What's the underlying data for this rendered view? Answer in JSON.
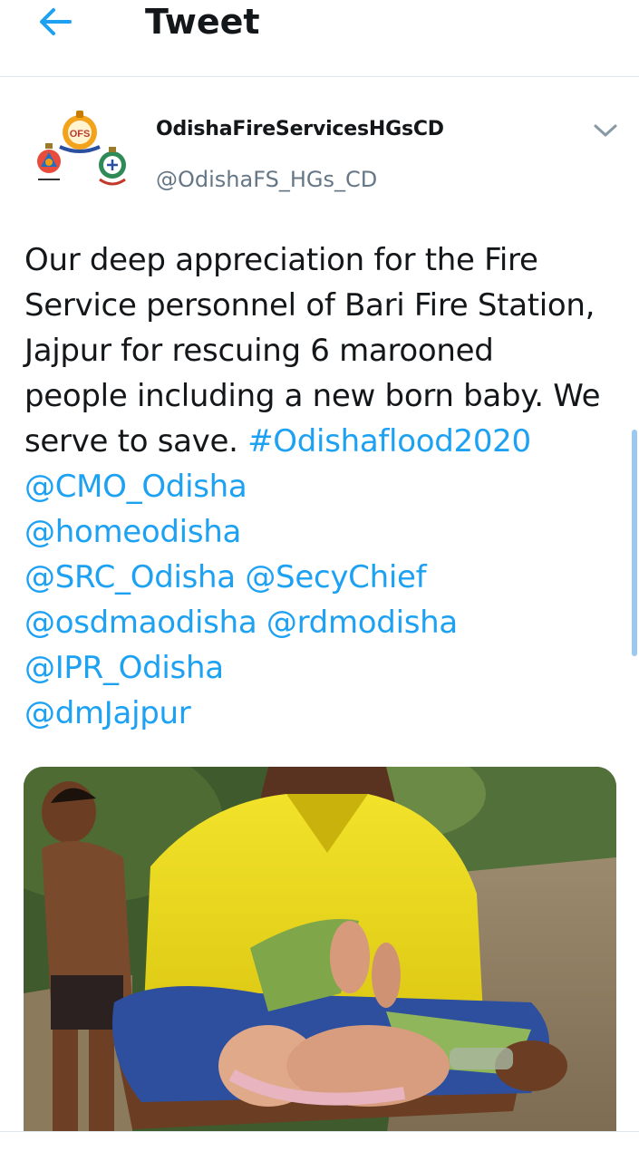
{
  "header": {
    "title": "Tweet",
    "back_icon": "arrow-left-icon"
  },
  "tweet": {
    "author_name": "OdishaFireServicesHGsCD",
    "author_handle": "@OdishaFS_HGs_CD",
    "avatar_logo_text": "OFS",
    "text_lines": {
      "l1": "Our deep appreciation for the Fire",
      "l2": "Service personnel of Bari Fire Station,",
      "l3": "Jajpur for rescuing 6 marooned",
      "l4": "people including a new born baby. We",
      "l5_plain": "serve to save. ",
      "hashtag": "#Odishaflood2020",
      "mention_cmo": "@CMO_Odisha",
      "mention_home": "@homeodisha",
      "mention_src": "@SRC_Odisha",
      "mention_secy": "@SecyChief",
      "mention_osdma": "@osdmaodisha",
      "mention_rdm": "@rdmodisha",
      "mention_ipr": "@IPR_Odisha",
      "mention_dm": "@dmJajpur"
    },
    "media_icon": "photo-rescue-baby",
    "caret_icon": "chevron-down-icon"
  },
  "colors": {
    "link": "#1da1f2",
    "text": "#14171a",
    "secondary": "#657786",
    "accent": "#1da1f2"
  }
}
